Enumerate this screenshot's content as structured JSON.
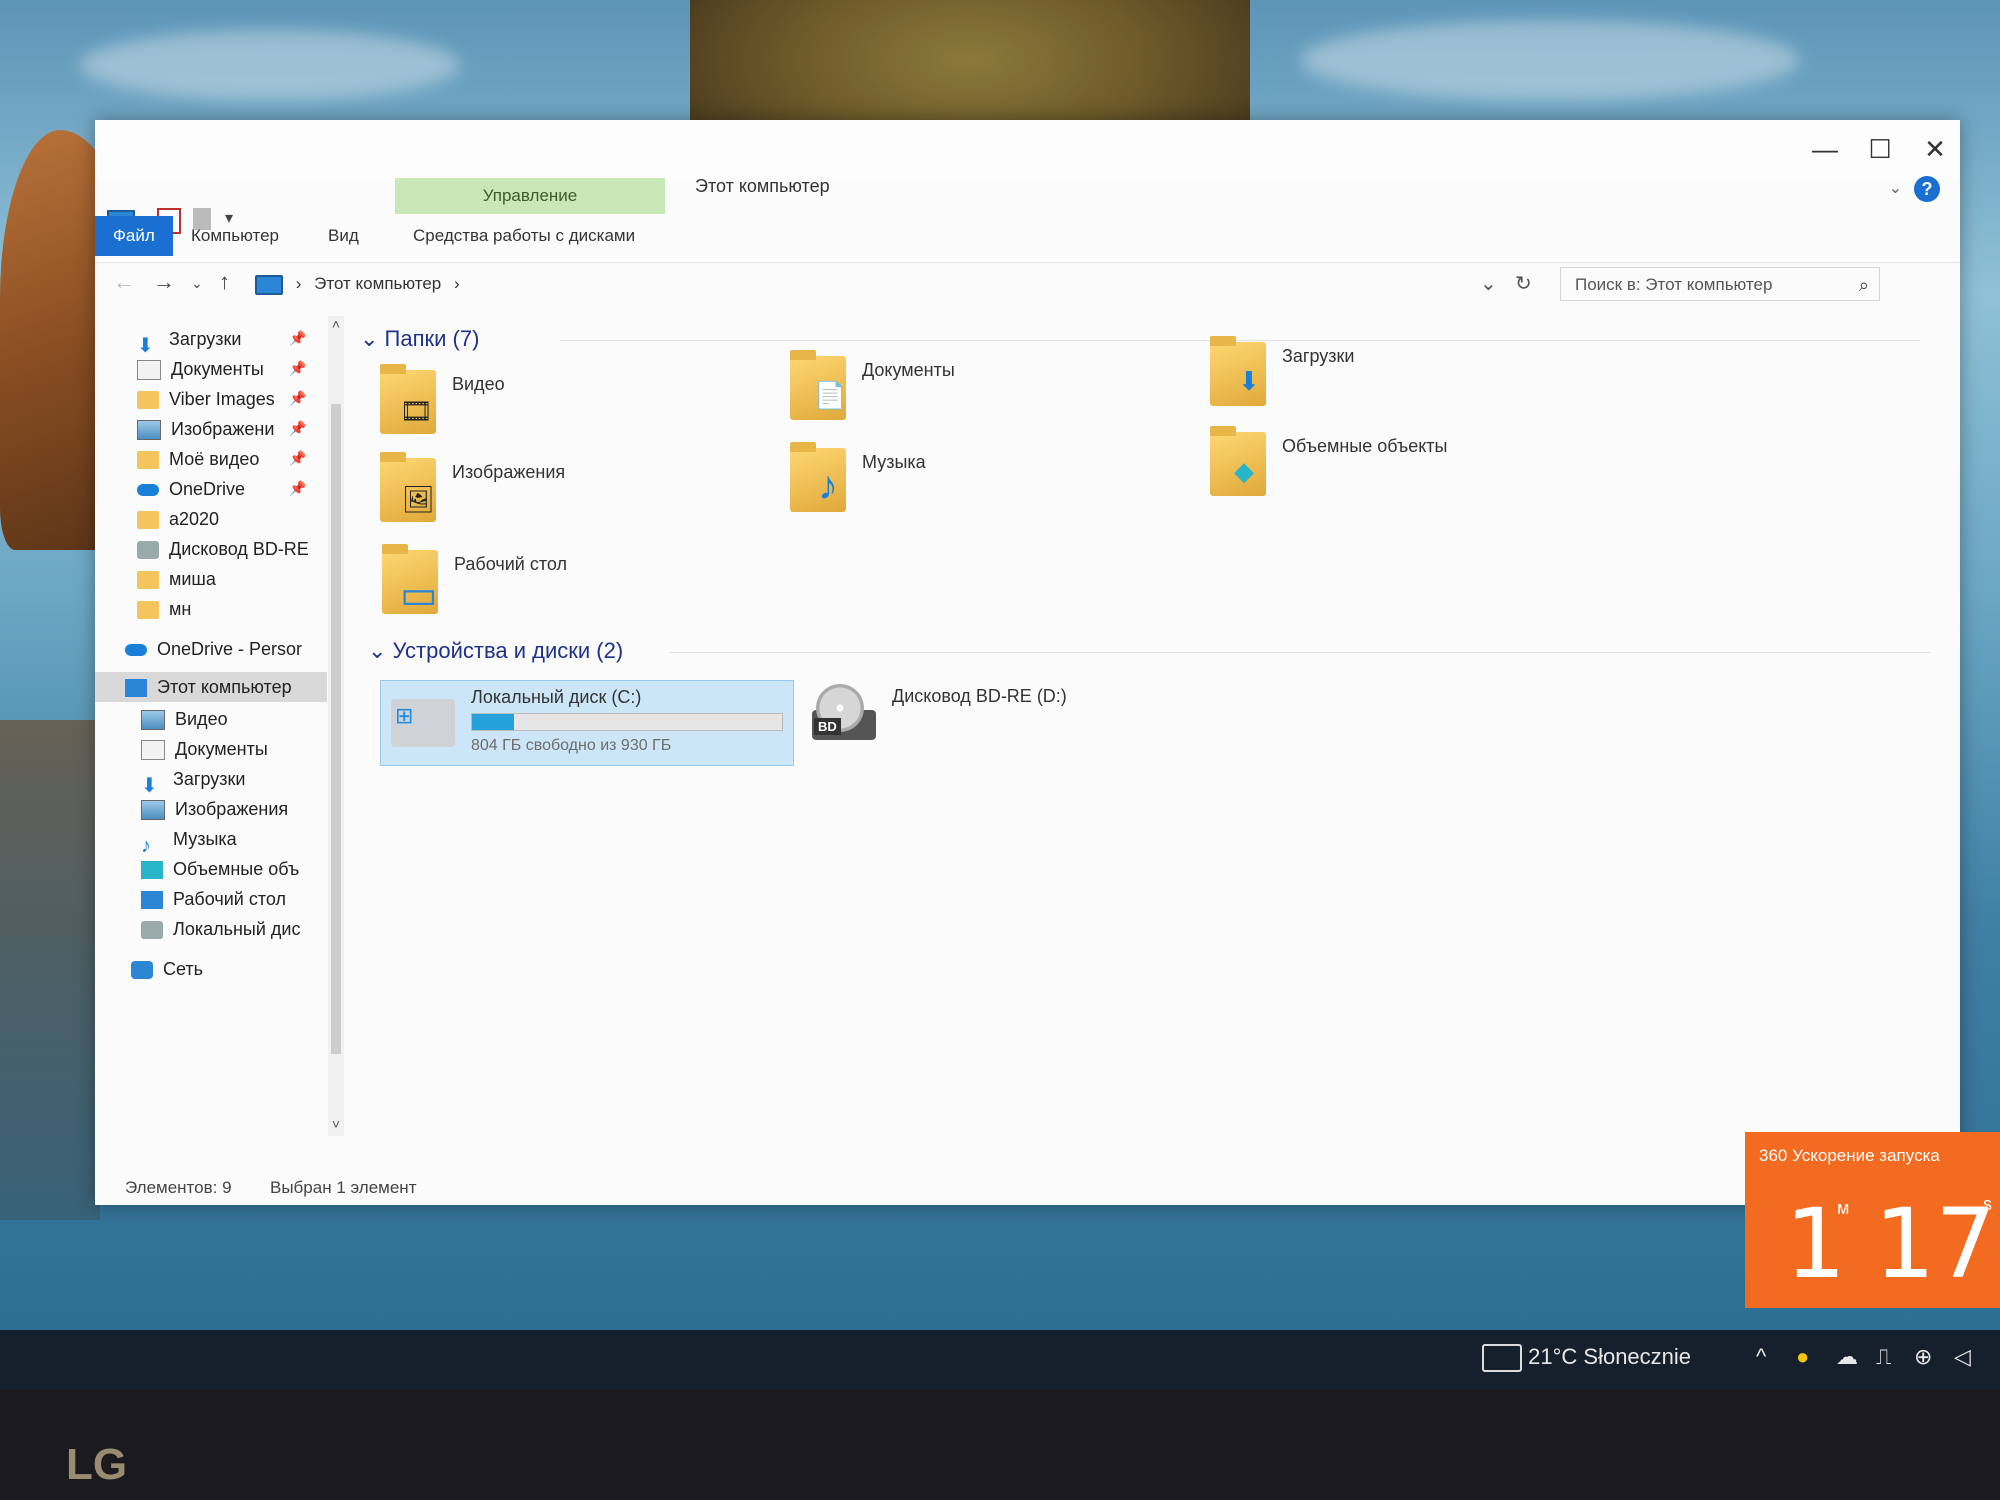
{
  "window": {
    "title": "Этот компьютер",
    "context_tab": "Управление",
    "tabs": [
      "Файл",
      "Компьютер",
      "Вид",
      "Средства работы с дисками"
    ],
    "controls": {
      "minimize": "—",
      "maximize": "☐",
      "close": "✕"
    },
    "help": "?"
  },
  "address": {
    "path": "Этот компьютер",
    "separator": "›",
    "search_placeholder": "Поиск в: Этот компьютер"
  },
  "nav": {
    "quick_access": [
      {
        "label": "Загрузки",
        "icon": "download-arrow-icon",
        "pinned": true
      },
      {
        "label": "Документы",
        "icon": "document-icon",
        "pinned": true
      },
      {
        "label": "Viber Images",
        "icon": "folder-icon",
        "pinned": true
      },
      {
        "label": "Изображени",
        "icon": "image-icon",
        "pinned": true
      },
      {
        "label": "Моё видео",
        "icon": "folder-icon",
        "pinned": true
      },
      {
        "label": "OneDrive",
        "icon": "cloud-icon",
        "pinned": true
      },
      {
        "label": "a2020",
        "icon": "folder-icon",
        "pinned": false
      },
      {
        "label": "Дисковод BD-RE",
        "icon": "optical-drive-icon",
        "pinned": false
      },
      {
        "label": "миша",
        "icon": "folder-icon",
        "pinned": false
      },
      {
        "label": "мн",
        "icon": "folder-icon",
        "pinned": false
      }
    ],
    "onedrive": "OneDrive - Persor",
    "this_pc": "Этот компьютер",
    "this_pc_children": [
      {
        "label": "Видео",
        "icon": "video-icon"
      },
      {
        "label": "Документы",
        "icon": "document-icon"
      },
      {
        "label": "Загрузки",
        "icon": "download-arrow-icon"
      },
      {
        "label": "Изображения",
        "icon": "image-icon"
      },
      {
        "label": "Музыка",
        "icon": "music-note-icon"
      },
      {
        "label": "Объемные объ",
        "icon": "3d-object-icon"
      },
      {
        "label": "Рабочий стол",
        "icon": "desktop-icon"
      },
      {
        "label": "Локальный дис",
        "icon": "local-disk-icon"
      }
    ],
    "network": "Сеть"
  },
  "folders_group": "Папки (7)",
  "folders": [
    {
      "label": "Видео",
      "badge": "🎞"
    },
    {
      "label": "Документы",
      "badge": "📄"
    },
    {
      "label": "Загрузки",
      "badge": "⬇"
    },
    {
      "label": "Изображения",
      "badge": "🖼"
    },
    {
      "label": "Музыка",
      "badge": "♪"
    },
    {
      "label": "Объемные объекты",
      "badge": "◆"
    },
    {
      "label": "Рабочий стол",
      "badge": "▭"
    }
  ],
  "devices_group": "Устройства и диски (2)",
  "drives": [
    {
      "label": "Локальный диск (C:)",
      "free_text": "804 ГБ свободно из 930 ГБ",
      "used_fraction": 0.135
    },
    {
      "label": "Дисковод BD-RE (D:)",
      "badge": "BD"
    }
  ],
  "status": {
    "items": "Элементов: 9",
    "selected": "Выбран 1 элемент"
  },
  "boost": {
    "title": "360 Ускорение запуска",
    "minutes": "1",
    "minutes_unit": "м",
    "seconds": "17",
    "seconds_unit": "s"
  },
  "taskbar": {
    "weather": "21°C  Słonecznie",
    "chevron": "^"
  },
  "bezel_logo": "LG",
  "colors": {
    "accent": "#1a6fd1",
    "context_tab": "#c9e8b7",
    "boost": "#f26b21",
    "progress": "#26a0da"
  }
}
